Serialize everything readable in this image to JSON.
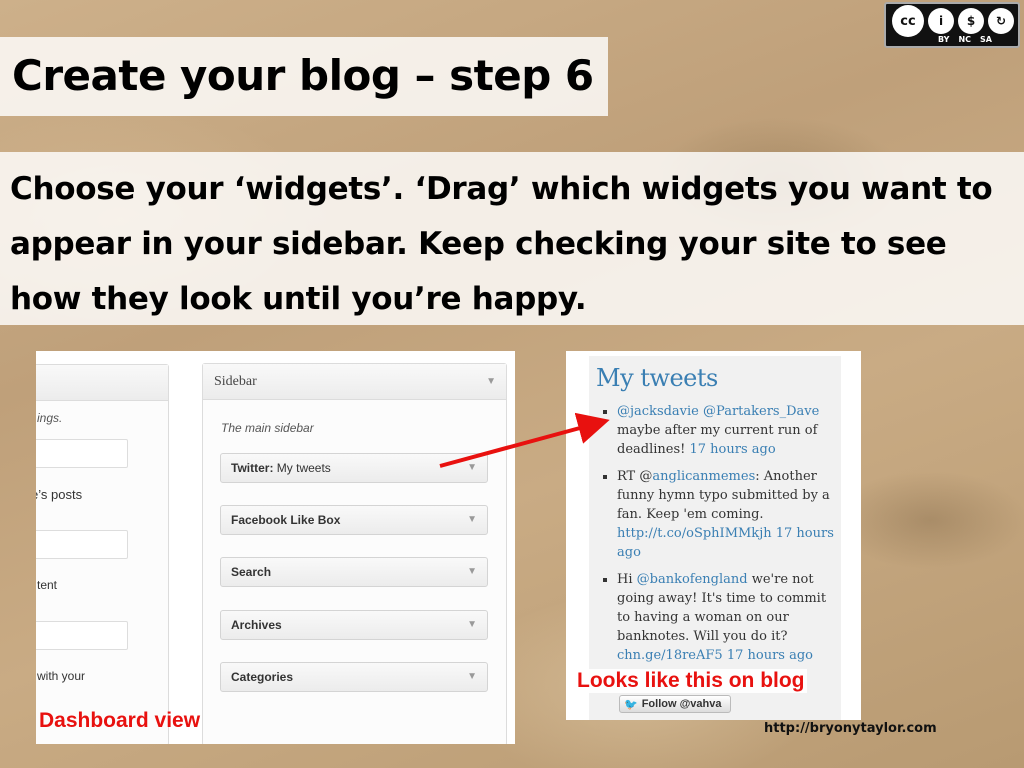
{
  "license": {
    "symbols": [
      "cc",
      "i",
      "$",
      "↻"
    ],
    "labels": [
      "BY",
      "NC",
      "SA"
    ]
  },
  "title": "Create your blog – step 6",
  "description": "Choose your ‘widgets’. ‘Drag’ which widgets you want to appear in your sidebar. Keep checking your site to see how they look until you’re happy.",
  "dashboard": {
    "left_panel_texts": [
      "ings.",
      "e’s posts",
      "tent",
      "with your"
    ],
    "sidebar": {
      "title": "Sidebar",
      "subtitle": "The main sidebar",
      "widgets": [
        {
          "name": "Twitter:",
          "detail": "My tweets"
        },
        {
          "name": "Facebook Like Box",
          "detail": ""
        },
        {
          "name": "Search",
          "detail": ""
        },
        {
          "name": "Archives",
          "detail": ""
        },
        {
          "name": "Categories",
          "detail": ""
        }
      ]
    },
    "caption": "Dashboard view"
  },
  "tweets": {
    "heading": "My tweets",
    "items": [
      {
        "parts": [
          {
            "t": "@jacksdavie",
            "link": true
          },
          {
            "t": " ",
            "link": false
          },
          {
            "t": "@Partakers_Dave",
            "link": true
          },
          {
            "t": " maybe after my current run of deadlines! ",
            "link": false
          },
          {
            "t": "17 hours ago",
            "link": true
          }
        ]
      },
      {
        "parts": [
          {
            "t": "RT @",
            "link": false
          },
          {
            "t": "anglicanmemes",
            "link": true
          },
          {
            "t": ": Another funny hymn typo submitted by a fan. Keep 'em coming. ",
            "link": false
          },
          {
            "t": "http://t.co/oSphIMMkjh",
            "link": true
          },
          {
            "t": " ",
            "link": false
          },
          {
            "t": "17 hours ago",
            "link": true
          }
        ]
      },
      {
        "parts": [
          {
            "t": "Hi ",
            "link": false
          },
          {
            "t": "@bankofengland",
            "link": true
          },
          {
            "t": " we're not going away! It's time to commit to having a woman on our banknotes. Will you do it? ",
            "link": false
          },
          {
            "t": "chn.ge/18reAF5",
            "link": true
          },
          {
            "t": " ",
            "link": false
          },
          {
            "t": "17 hours ago",
            "link": true
          }
        ]
      }
    ],
    "follow_button": "Follow @vahva",
    "caption": "Looks like this on blog"
  },
  "source_url": "http://bryonytaylor.com",
  "colors": {
    "caption_red": "#e8110f",
    "link_blue": "#3a7fb3",
    "arrow_red": "#e8110f"
  }
}
